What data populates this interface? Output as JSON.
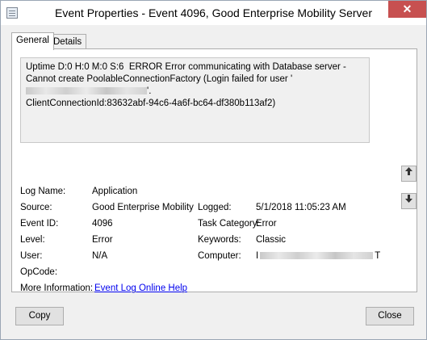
{
  "window": {
    "title": "Event Properties - Event 4096, Good Enterprise Mobility Server",
    "close_glyph": "✕"
  },
  "tabs": [
    {
      "label": "General",
      "active": true
    },
    {
      "label": "Details",
      "active": false
    }
  ],
  "description": {
    "part1": "Uptime D:0 H:0 M:0 S:6  ERROR Error communicating with Database server -Cannot create PoolableConnectionFactory (Login failed for user '",
    "part2": "'.",
    "part3": "ClientConnectionId:83632abf-94c6-4a6f-bc64-df380b113af2)"
  },
  "fields": {
    "log_name": {
      "label": "Log Name:",
      "value": "Application"
    },
    "source": {
      "label": "Source:",
      "value": "Good Enterprise Mobility Ser"
    },
    "logged": {
      "label": "Logged:",
      "value": "5/1/2018 11:05:23 AM"
    },
    "event_id": {
      "label": "Event ID:",
      "value": "4096"
    },
    "task_category": {
      "label": "Task Category:",
      "value": "Error"
    },
    "level": {
      "label": "Level:",
      "value": "Error"
    },
    "keywords": {
      "label": "Keywords:",
      "value": "Classic"
    },
    "user": {
      "label": "User:",
      "value": "N/A"
    },
    "computer": {
      "label": "Computer:",
      "value_prefix": "I",
      "value_suffix": "T"
    },
    "opcode": {
      "label": "OpCode:",
      "value": ""
    },
    "more_info": {
      "label": "More Information:",
      "link": "Event Log Online Help"
    }
  },
  "nav": {
    "up_icon": "up-arrow-icon",
    "down_icon": "down-arrow-icon"
  },
  "buttons": {
    "copy": "Copy",
    "close": "Close"
  },
  "colors": {
    "close_button": "#c75050",
    "link": "#0000ee"
  }
}
